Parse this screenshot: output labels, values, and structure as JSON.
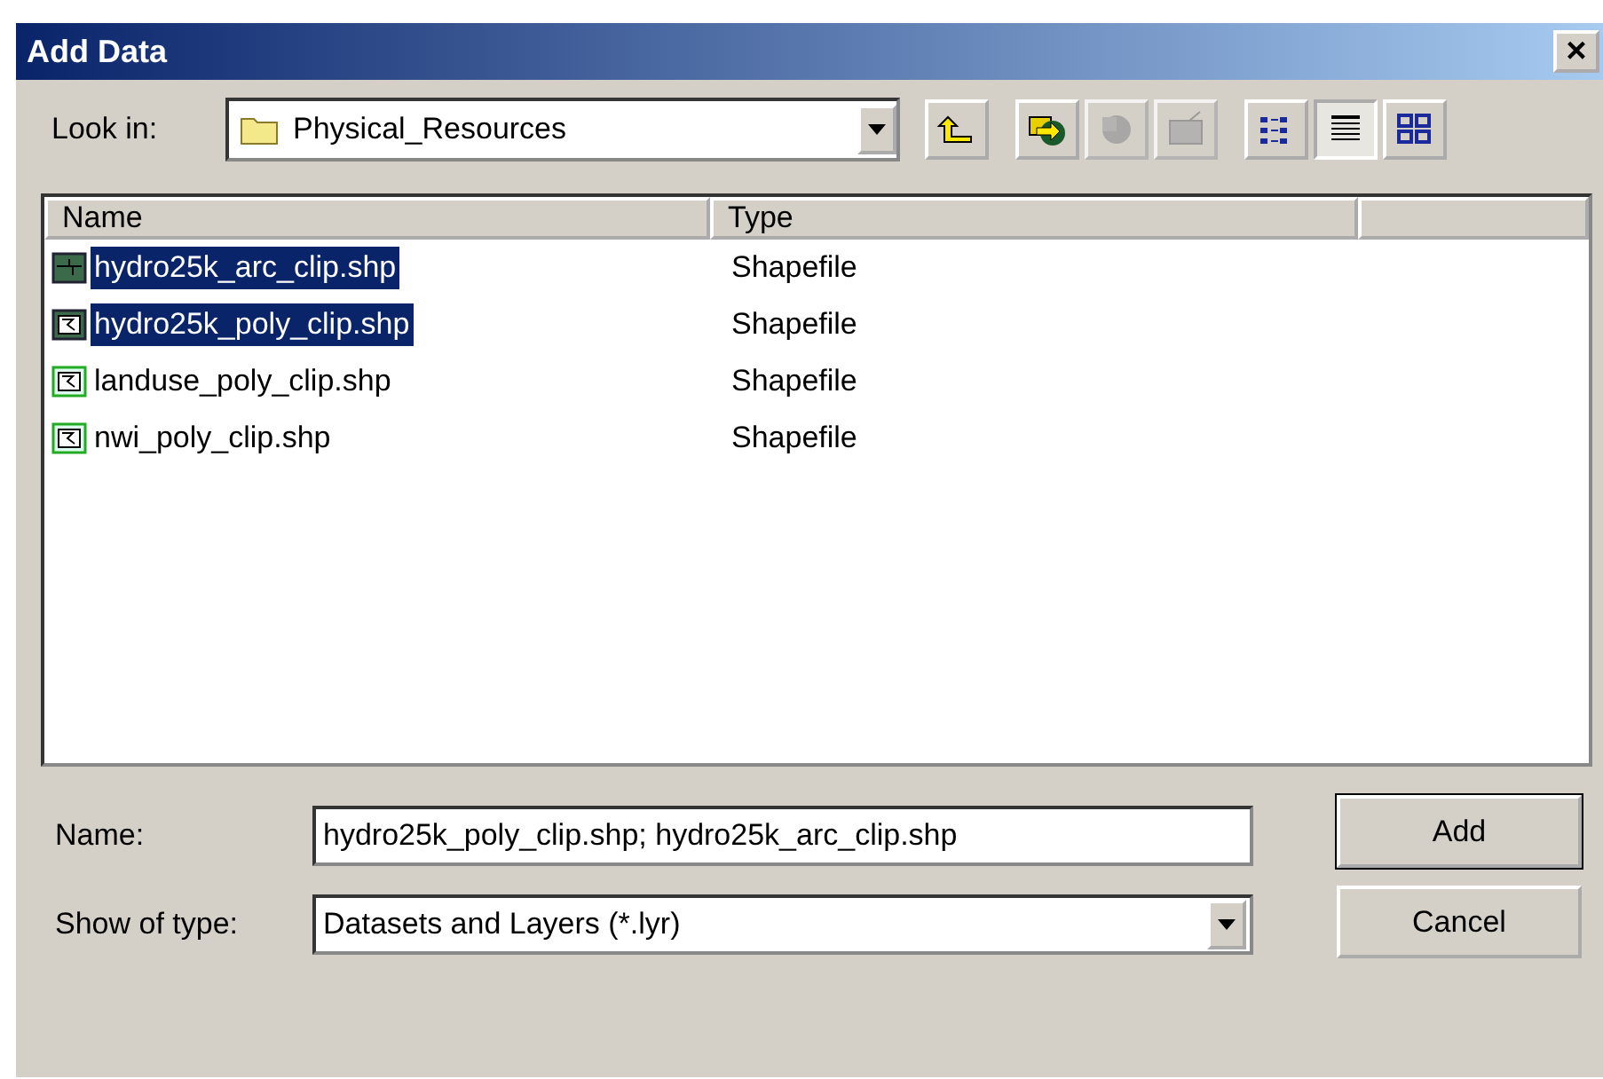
{
  "window": {
    "title": "Add Data",
    "close": "×"
  },
  "look_in": {
    "label": "Look in:",
    "value": "Physical_Resources"
  },
  "toolbar": [
    {
      "kind": "up",
      "disabled": false,
      "selected": false
    },
    {
      "kind": "connect",
      "disabled": false,
      "selected": false
    },
    {
      "kind": "disconnect",
      "disabled": true,
      "selected": false
    },
    {
      "kind": "catalog",
      "disabled": true,
      "selected": false
    },
    {
      "kind": "list",
      "disabled": false,
      "selected": false
    },
    {
      "kind": "details",
      "disabled": false,
      "selected": true
    },
    {
      "kind": "thumbnails",
      "disabled": false,
      "selected": false
    }
  ],
  "table": {
    "columns": [
      "Name",
      "Type"
    ],
    "rows": [
      {
        "name": "hydro25k_arc_clip.shp",
        "type": "Shapefile",
        "kind": "line",
        "selected": true
      },
      {
        "name": "hydro25k_poly_clip.shp",
        "type": "Shapefile",
        "kind": "polygon",
        "selected": true
      },
      {
        "name": "landuse_poly_clip.shp",
        "type": "Shapefile",
        "kind": "polygon",
        "selected": false
      },
      {
        "name": "nwi_poly_clip.shp",
        "type": "Shapefile",
        "kind": "polygon",
        "selected": false
      }
    ]
  },
  "name_field": {
    "label": "Name:",
    "value": "hydro25k_poly_clip.shp; hydro25k_arc_clip.shp"
  },
  "type_field": {
    "label": "Show of type:",
    "value": "Datasets and Layers (*.lyr)"
  },
  "buttons": [
    "Add",
    "Cancel"
  ]
}
